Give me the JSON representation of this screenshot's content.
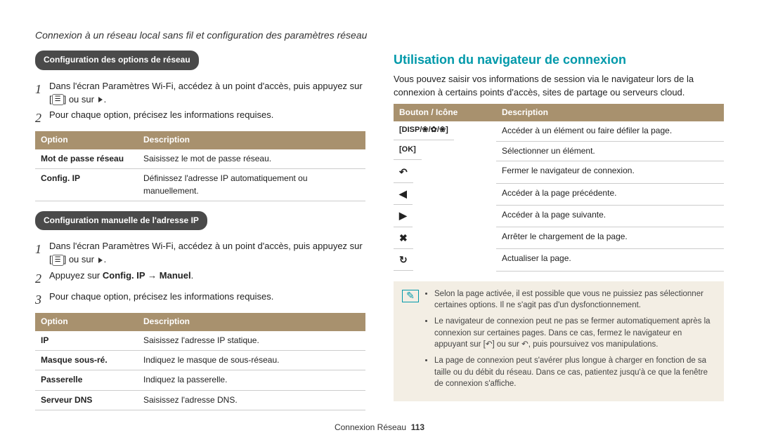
{
  "header": {
    "breadcrumb": "Connexion à un réseau local sans fil et configuration des paramètres réseau"
  },
  "left": {
    "section1": {
      "title": "Configuration des options de réseau",
      "step1": "Dans l'écran Paramètres Wi-Fi, accédez à un point d'accès, puis appuyez sur [",
      "step1b": "] ou sur ",
      "step1c": ".",
      "step2": "Pour chaque option, précisez les informations requises.",
      "table": {
        "h1": "Option",
        "h2": "Description",
        "rows": [
          {
            "k": "Mot de passe réseau",
            "v": "Saisissez le mot de passe réseau."
          },
          {
            "k": "Config. IP",
            "v": "Définissez l'adresse IP automatiquement ou manuellement."
          }
        ]
      }
    },
    "section2": {
      "title": "Configuration manuelle de l'adresse IP",
      "step1": "Dans l'écran Paramètres Wi-Fi, accédez à un point d'accès, puis appuyez sur [",
      "step1b": "] ou sur ",
      "step1c": ".",
      "step2a": "Appuyez sur ",
      "step2b": "Config. IP",
      "step2arrow": " → ",
      "step2c": "Manuel",
      "step2d": ".",
      "step3": "Pour chaque option, précisez les informations requises.",
      "table": {
        "h1": "Option",
        "h2": "Description",
        "rows": [
          {
            "k": "IP",
            "v": "Saisissez l'adresse IP statique."
          },
          {
            "k": "Masque sous-ré.",
            "v": "Indiquez le masque de sous-réseau."
          },
          {
            "k": "Passerelle",
            "v": "Indiquez la passerelle."
          },
          {
            "k": "Serveur DNS",
            "v": "Saisissez l'adresse DNS."
          }
        ]
      }
    }
  },
  "right": {
    "heading": "Utilisation du navigateur de connexion",
    "intro": "Vous pouvez saisir vos informations de session via le navigateur lors de la connexion à certains points d'accès, sites de partage ou serveurs cloud.",
    "table": {
      "h1": "Bouton / Icône",
      "h2": "Description",
      "rows": [
        {
          "icon": "[DISP/❀/✿/❀]",
          "v": "Accéder à un élément ou faire défiler la page."
        },
        {
          "icon": "[OK]",
          "v": "Sélectionner un élément."
        },
        {
          "icon": "↶",
          "v": "Fermer le navigateur de connexion."
        },
        {
          "icon": "◀",
          "v": "Accéder à la page précédente."
        },
        {
          "icon": "▶",
          "v": "Accéder à la page suivante."
        },
        {
          "icon": "✖",
          "v": "Arrêter le chargement de la page."
        },
        {
          "icon": "↻",
          "v": "Actualiser la page."
        }
      ]
    },
    "notes": [
      "Selon la page activée, il est possible que vous ne puissiez pas sélectionner certaines options. Il ne s'agit pas d'un dysfonctionnement.",
      "Le navigateur de connexion peut ne pas se fermer automatiquement après la connexion sur certaines pages. Dans ce cas, fermez le navigateur en appuyant sur [↶] ou sur ↶, puis poursuivez vos manipulations.",
      "La page de connexion peut s'avérer plus longue à charger en fonction de sa taille ou du débit du réseau. Dans ce cas, patientez jusqu'à ce que la fenêtre de connexion s'affiche."
    ]
  },
  "footer": {
    "section": "Connexion Réseau",
    "page": "113"
  },
  "icons": {
    "menu": "☰"
  }
}
